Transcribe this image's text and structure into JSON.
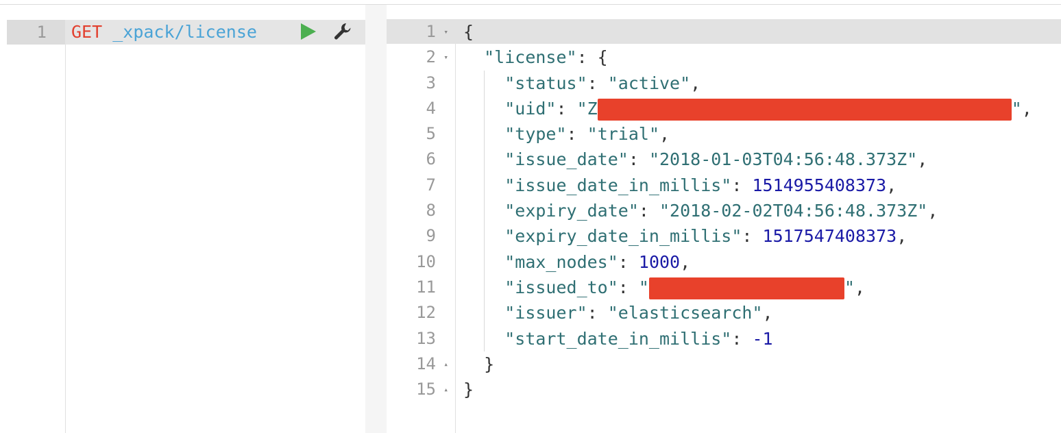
{
  "request": {
    "line_number": "1",
    "method": "GET",
    "url": "_xpack/license",
    "run_icon": "play-icon",
    "settings_icon": "wrench-icon"
  },
  "response": {
    "lines": [
      {
        "num": "1",
        "fold": "▾"
      },
      {
        "num": "2",
        "fold": "▾"
      },
      {
        "num": "3",
        "fold": ""
      },
      {
        "num": "4",
        "fold": ""
      },
      {
        "num": "5",
        "fold": ""
      },
      {
        "num": "6",
        "fold": ""
      },
      {
        "num": "7",
        "fold": ""
      },
      {
        "num": "8",
        "fold": ""
      },
      {
        "num": "9",
        "fold": ""
      },
      {
        "num": "10",
        "fold": ""
      },
      {
        "num": "11",
        "fold": ""
      },
      {
        "num": "12",
        "fold": ""
      },
      {
        "num": "13",
        "fold": ""
      },
      {
        "num": "14",
        "fold": "▴"
      },
      {
        "num": "15",
        "fold": "▴"
      }
    ],
    "open_brace": "{",
    "close_brace": "}",
    "license_key": "\"license\"",
    "fields": {
      "status_key": "\"status\"",
      "status_val": "\"active\"",
      "uid_key": "\"uid\"",
      "uid_val_prefix": "\"Z",
      "uid_val_suffix": "\"",
      "type_key": "\"type\"",
      "type_val": "\"trial\"",
      "issue_date_key": "\"issue_date\"",
      "issue_date_val": "\"2018-01-03T04:56:48.373Z\"",
      "issue_date_in_millis_key": "\"issue_date_in_millis\"",
      "issue_date_in_millis_val": "1514955408373",
      "expiry_date_key": "\"expiry_date\"",
      "expiry_date_val": "\"2018-02-02T04:56:48.373Z\"",
      "expiry_date_in_millis_key": "\"expiry_date_in_millis\"",
      "expiry_date_in_millis_val": "1517547408373",
      "max_nodes_key": "\"max_nodes\"",
      "max_nodes_val": "1000",
      "issued_to_key": "\"issued_to\"",
      "issued_to_val_prefix": "\"",
      "issued_to_val_suffix": "\"",
      "issuer_key": "\"issuer\"",
      "issuer_val": "\"elasticsearch\"",
      "start_date_in_millis_key": "\"start_date_in_millis\"",
      "start_date_in_millis_val": "-1"
    },
    "redaction_color": "#e8412b"
  },
  "colors": {
    "method": "#e2402f",
    "url": "#4aa3d6",
    "string": "#2f6f73",
    "number": "#1a1aa6",
    "run": "#4caf50"
  }
}
